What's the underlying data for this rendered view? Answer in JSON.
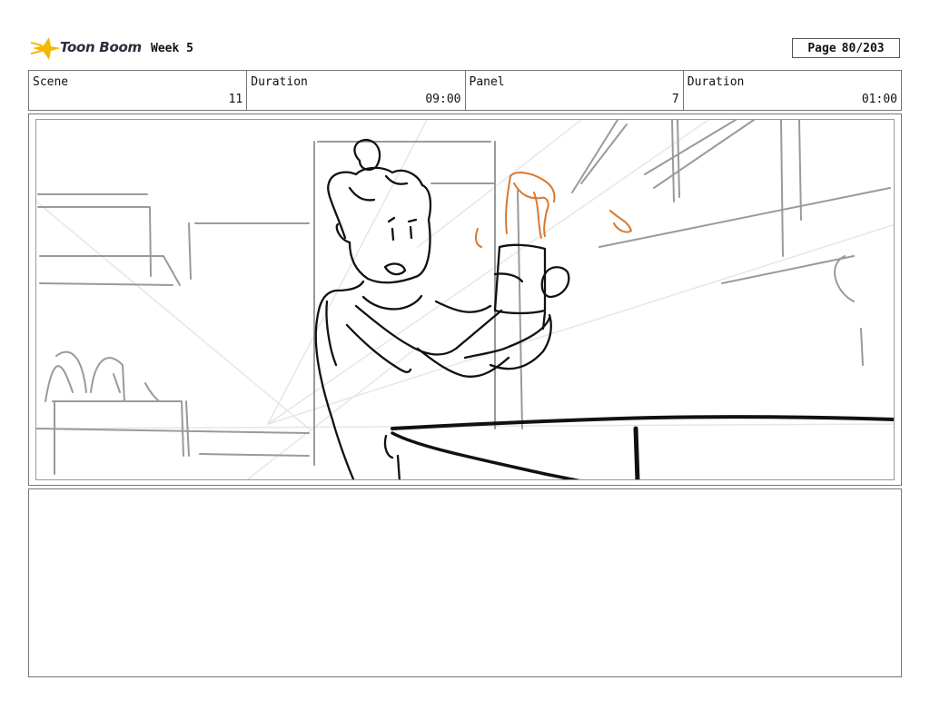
{
  "header": {
    "logo_text": "Toon Boom",
    "project_title": "Week 5",
    "page_label": "Page",
    "page_value": "80/203"
  },
  "info": {
    "scene_label": "Scene",
    "scene_value": "11",
    "scene_duration_label": "Duration",
    "scene_duration_value": "09:00",
    "panel_label": "Panel",
    "panel_value": "7",
    "panel_duration_label": "Duration",
    "panel_duration_value": "01:00"
  },
  "colors": {
    "logo_star": "#f5b800",
    "sketch_line": "#111111",
    "sketch_gray": "#9a9a9a",
    "sketch_orange": "#d9782e"
  },
  "notes": {
    "text": ""
  }
}
